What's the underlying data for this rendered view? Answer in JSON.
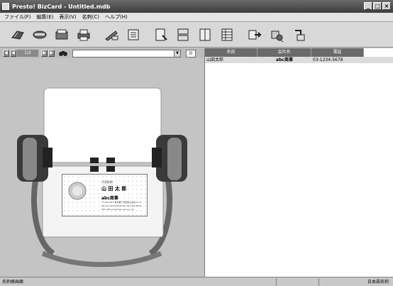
{
  "window": {
    "title": "Presto! BizCard - Untitled.mdb",
    "minimize": "_",
    "maximize": "□",
    "close": "×"
  },
  "menu": [
    "ファイル(F)",
    "編集(E)",
    "表示(V)",
    "名刺(C)",
    "ヘルプ(H)"
  ],
  "navigation": {
    "page": "1/2",
    "search_value": "",
    "dropdown": "▼",
    "view_button": "|||"
  },
  "card": {
    "title_small": "代表取締",
    "name": "山 田 太 郎",
    "company": "abc商事",
    "address_lines": [
      "〒102-0073 東京都千代田区九段北1-2-3",
      "TEL 03-1234-5678   FAX 03-1234-5679",
      "URL http://www.abc-shoji.co.jp"
    ]
  },
  "table": {
    "columns": [
      "名前",
      "会社名",
      "電話"
    ],
    "rows": [
      {
        "name": "山田太郎",
        "company": "abc商事",
        "phone": "03-1234-5678"
      }
    ]
  },
  "status": {
    "left": "名刺帳画面",
    "right": "日本語名刺"
  },
  "icons": [
    "open-card-icon",
    "scan-icon",
    "cardbox-icon",
    "print-icon",
    "edit-card-icon",
    "sort-icon",
    "view-single-icon",
    "view-list-icon",
    "view-thumbnail-icon",
    "view-table-icon",
    "export-icon",
    "send-icon",
    "sync-icon"
  ]
}
